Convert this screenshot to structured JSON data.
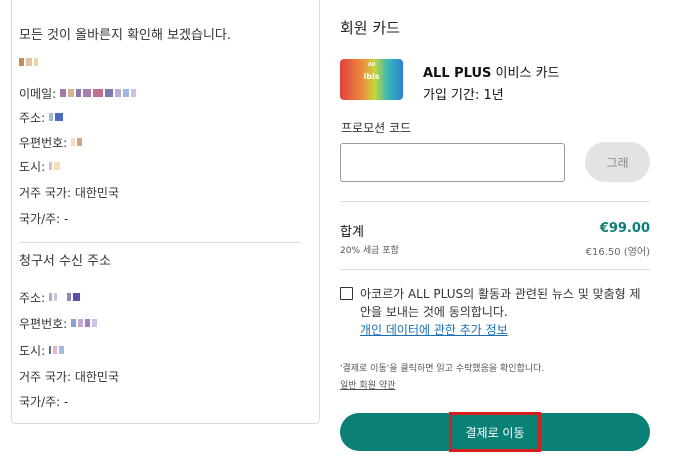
{
  "left": {
    "confirm_text": "모든 것이 올바른지 확인해 보겠습니다.",
    "email_label": "이메일:",
    "address_label": "주소:",
    "postal_label": "우편번호:",
    "city_label": "도시:",
    "country": "거주 국가: 대한민국",
    "state": "국가/주: -",
    "billing_title": "청구서 수신 주소",
    "billing_address_label": "주소:",
    "billing_postal_label": "우편번호:",
    "billing_city_label": "도시:",
    "billing_country": "거주 국가: 대한민국",
    "billing_state": "국가/주: -"
  },
  "right": {
    "title": "회원 카드",
    "card_image_all": "All",
    "card_image_ibis": "ibis",
    "card_name_bold": "ALL PLUS",
    "card_name_rest": " 이비스 카드",
    "card_period": "가입 기간: 1년",
    "promo_label": "프로모션 코드",
    "promo_value": "",
    "apply_label": "그래",
    "total_label": "합계",
    "total_value": "€99.00",
    "tax_label": "20% 세금 포함",
    "tax_value": "€16.50 (영어)",
    "consent_text": "아코르가 ALL PLUS의 활동과 관련된 뉴스 및 맞춤형 제안을 보내는 것에 동의합니다.",
    "consent_link": "개인 데이터에 관한 추가 정보",
    "terms_text": "'결제로 이동'을 클릭하면 읽고 수락했음을 확인합니다.",
    "terms_link": "일반 회원 약관",
    "go_button": "결제로 이동"
  },
  "colors": {
    "accent": "#0b8076",
    "total": "#0b7f75",
    "link": "#1a6fb3",
    "highlight_border": "#d7201e"
  }
}
